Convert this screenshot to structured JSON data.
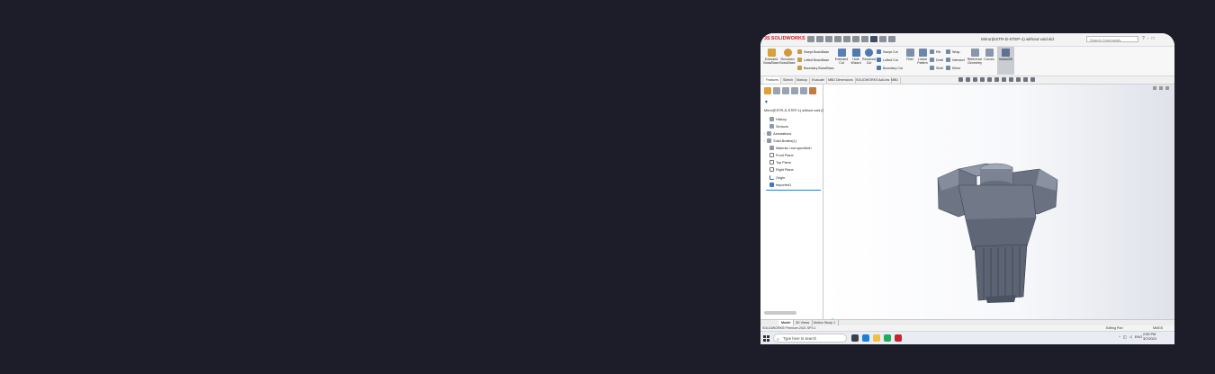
{
  "app": {
    "brand": "SOLIDWORKS",
    "document_title": "Mirror(ESTR-D-STEP-1) without void.sld",
    "search_placeholder": "Search Commands",
    "window_controls": [
      "?",
      "-",
      "□"
    ]
  },
  "ribbon": {
    "buttons": [
      {
        "label": "Extruded Boss/Base",
        "icon": "extruded-boss-icon"
      },
      {
        "label": "Revolved Boss/Base",
        "icon": "revolved-boss-icon"
      },
      {
        "label": "Extruded Cut",
        "icon": "extruded-cut-icon"
      },
      {
        "label": "Hole Wizard",
        "icon": "hole-wizard-icon"
      },
      {
        "label": "Revolved Cut",
        "icon": "revolved-cut-icon"
      },
      {
        "label": "Fillet",
        "icon": "fillet-icon"
      },
      {
        "label": "Linear Pattern",
        "icon": "linear-pattern-icon"
      },
      {
        "label": "Reference Geometry",
        "icon": "reference-geometry-icon"
      },
      {
        "label": "Curves",
        "icon": "curves-icon"
      },
      {
        "label": "Instant3D",
        "icon": "instant3d-icon"
      }
    ],
    "small": [
      {
        "label": "Swept Boss/Base"
      },
      {
        "label": "Lofted Boss/Base"
      },
      {
        "label": "Boundary Boss/Base"
      },
      {
        "label": "Swept Cut"
      },
      {
        "label": "Lofted Cut"
      },
      {
        "label": "Boundary Cut"
      },
      {
        "label": "Rib"
      },
      {
        "label": "Draft"
      },
      {
        "label": "Shell"
      },
      {
        "label": "Wrap"
      },
      {
        "label": "Intersect"
      },
      {
        "label": "Mirror"
      }
    ]
  },
  "tabs": [
    {
      "label": "Features",
      "active": true
    },
    {
      "label": "Sketch"
    },
    {
      "label": "Markup"
    },
    {
      "label": "Evaluate"
    },
    {
      "label": "MBD Dimensions"
    },
    {
      "label": "SOLIDWORKS Add-ins"
    },
    {
      "label": "MBD"
    }
  ],
  "tree": {
    "root": "Mirror(ESTR-D-STEP-1) without void (Default<<Default>)",
    "items": [
      {
        "label": "History",
        "icon": "history-icon"
      },
      {
        "label": "Sensors",
        "icon": "sensors-icon"
      },
      {
        "label": "Annotations",
        "icon": "annotations-icon"
      },
      {
        "label": "Solid Bodies(1)",
        "icon": "solid-bodies-icon"
      },
      {
        "label": "Material <not specified>",
        "icon": "material-icon"
      },
      {
        "label": "Front Plane",
        "icon": "plane-icon"
      },
      {
        "label": "Top Plane",
        "icon": "plane-icon"
      },
      {
        "label": "Right Plane",
        "icon": "plane-icon"
      },
      {
        "label": "Origin",
        "icon": "origin-icon"
      },
      {
        "label": "Imported1",
        "icon": "imported-body-icon"
      }
    ]
  },
  "bottom_tabs": [
    {
      "label": "Model",
      "active": true
    },
    {
      "label": "3D Views"
    },
    {
      "label": "Motion Study 1"
    }
  ],
  "status": {
    "left": "SOLIDWORKS Premium 2021 SP3.1",
    "mode": "Editing Part",
    "units": "MMGS"
  },
  "taskbar": {
    "search_placeholder": "Type here to search",
    "language": "ENG",
    "region": "IN",
    "time": "2:59 PM",
    "date": "3/7/2023"
  },
  "colors": {
    "background": "#1d1c29",
    "brand_red": "#cc1f2a",
    "model_gray": "#6d7585",
    "viewport_gradient_end": "#dfe2ea"
  }
}
